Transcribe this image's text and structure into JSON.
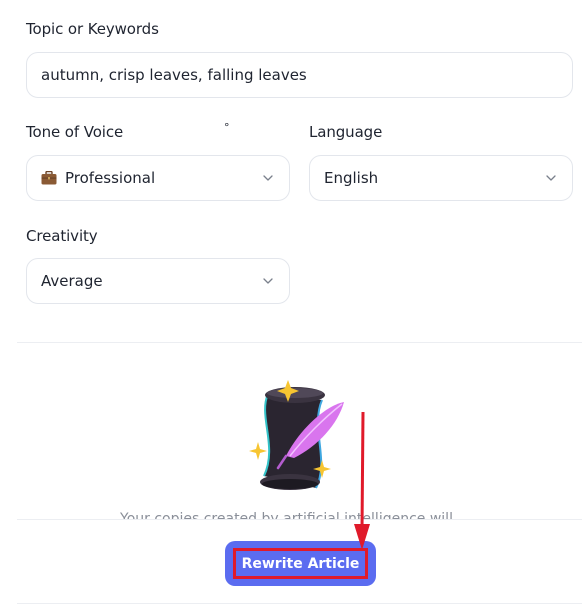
{
  "form": {
    "topic": {
      "label": "Topic or Keywords",
      "value": "autumn, crisp leaves, falling leaves"
    },
    "tone": {
      "label": "Tone of Voice",
      "marker": "°",
      "value": "Professional",
      "icon": "briefcase-icon"
    },
    "language": {
      "label": "Language",
      "value": "English"
    },
    "creativity": {
      "label": "Creativity",
      "value": "Average"
    }
  },
  "empty_state": {
    "illustration": "scroll-quill-icon",
    "text": "Your copies created by artificial intelligence will"
  },
  "actions": {
    "rewrite_label": "Rewrite Article",
    "button_color": "#5b6cf0",
    "highlight_color": "#e01a2a"
  },
  "annotation": {
    "arrow_color": "#e01a2a"
  }
}
